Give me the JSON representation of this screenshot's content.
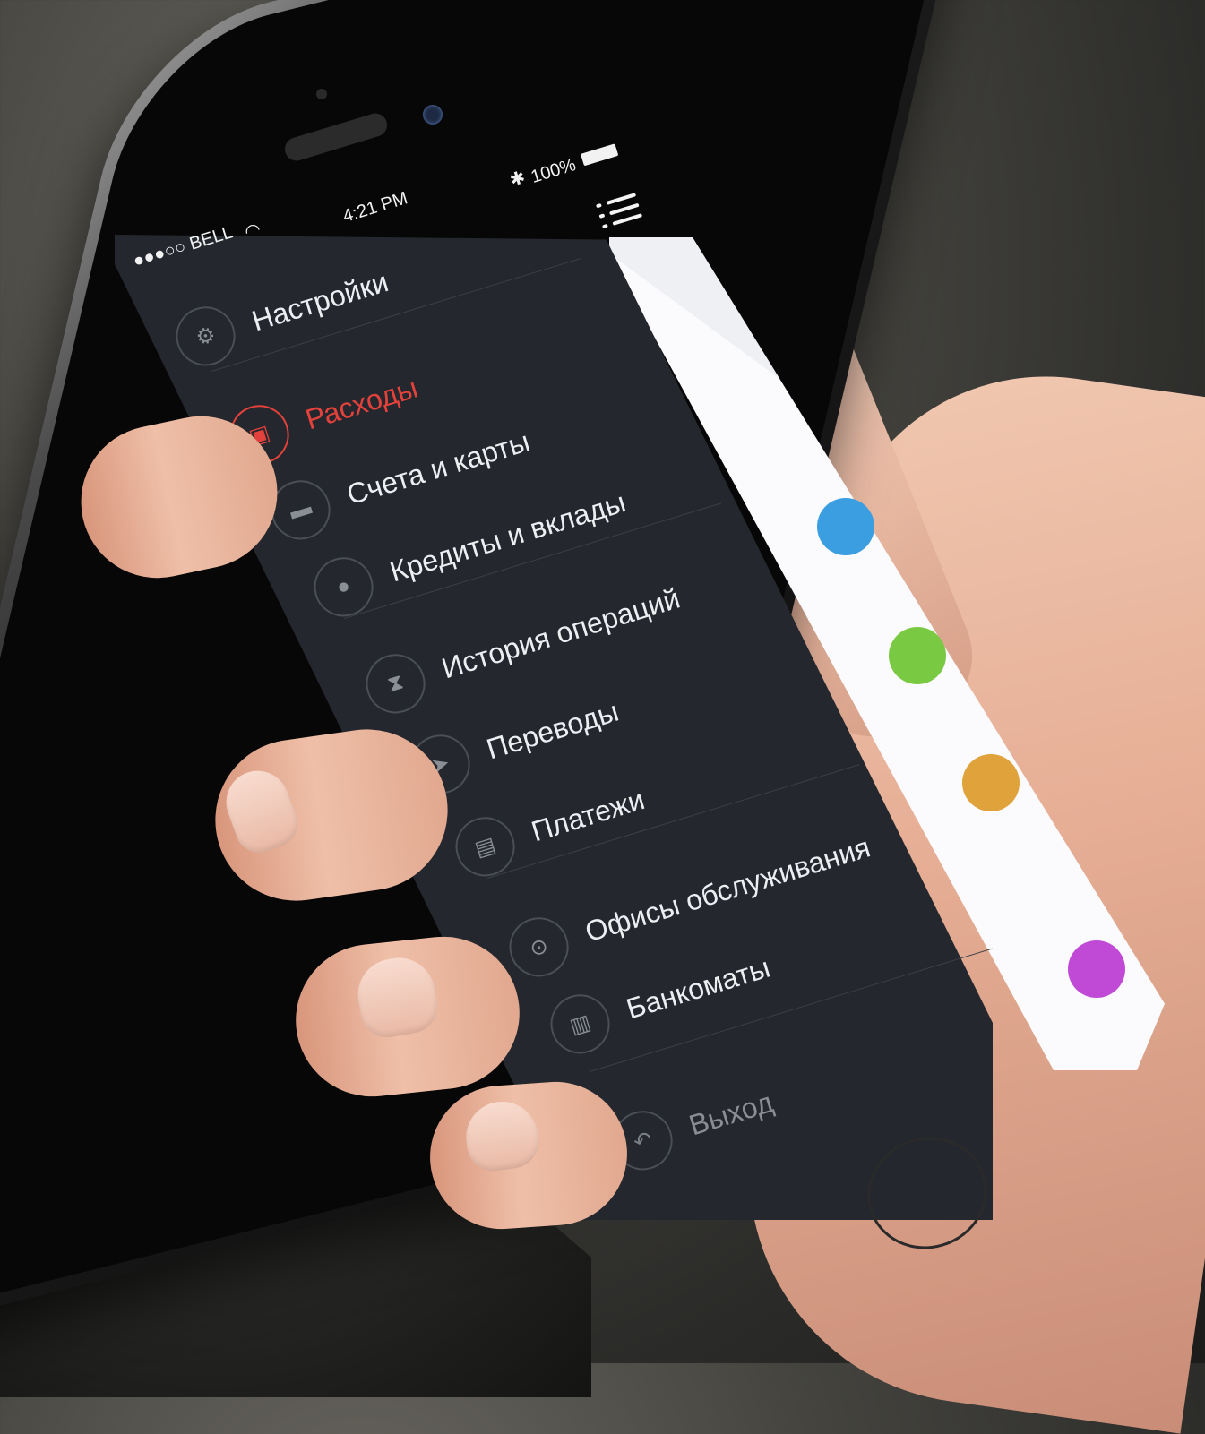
{
  "status_bar": {
    "carrier": "●●●○○ BELL",
    "time": "4:21 PM",
    "battery": "100%"
  },
  "colors": {
    "panel_bg": "#24272d",
    "accent": "#e2423b",
    "text": "#eceef1",
    "muted": "#8a8d92",
    "badge_blue": "#3a9ee0",
    "badge_green": "#7ac943",
    "badge_orange": "#e0a23a",
    "badge_purple": "#c04ad6"
  },
  "menu": {
    "items": [
      {
        "label": "Настройки",
        "icon": "gear-icon",
        "state": "normal"
      },
      {
        "label": "Расходы",
        "icon": "presentation-icon",
        "state": "active"
      },
      {
        "label": "Счета и карты",
        "icon": "card-icon",
        "state": "normal"
      },
      {
        "label": "Кредиты и вклады",
        "icon": "piggy-bank-icon",
        "state": "normal"
      },
      {
        "label": "История операций",
        "icon": "hourglass-icon",
        "state": "normal"
      },
      {
        "label": "Переводы",
        "icon": "paper-plane-icon",
        "state": "normal"
      },
      {
        "label": "Платежи",
        "icon": "wallet-icon",
        "state": "normal"
      },
      {
        "label": "Офисы обслуживания",
        "icon": "map-pin-icon",
        "state": "normal"
      },
      {
        "label": "Банкоматы",
        "icon": "atm-icon",
        "state": "normal"
      },
      {
        "label": "Выход",
        "icon": "back-arrow-icon",
        "state": "muted"
      }
    ]
  }
}
